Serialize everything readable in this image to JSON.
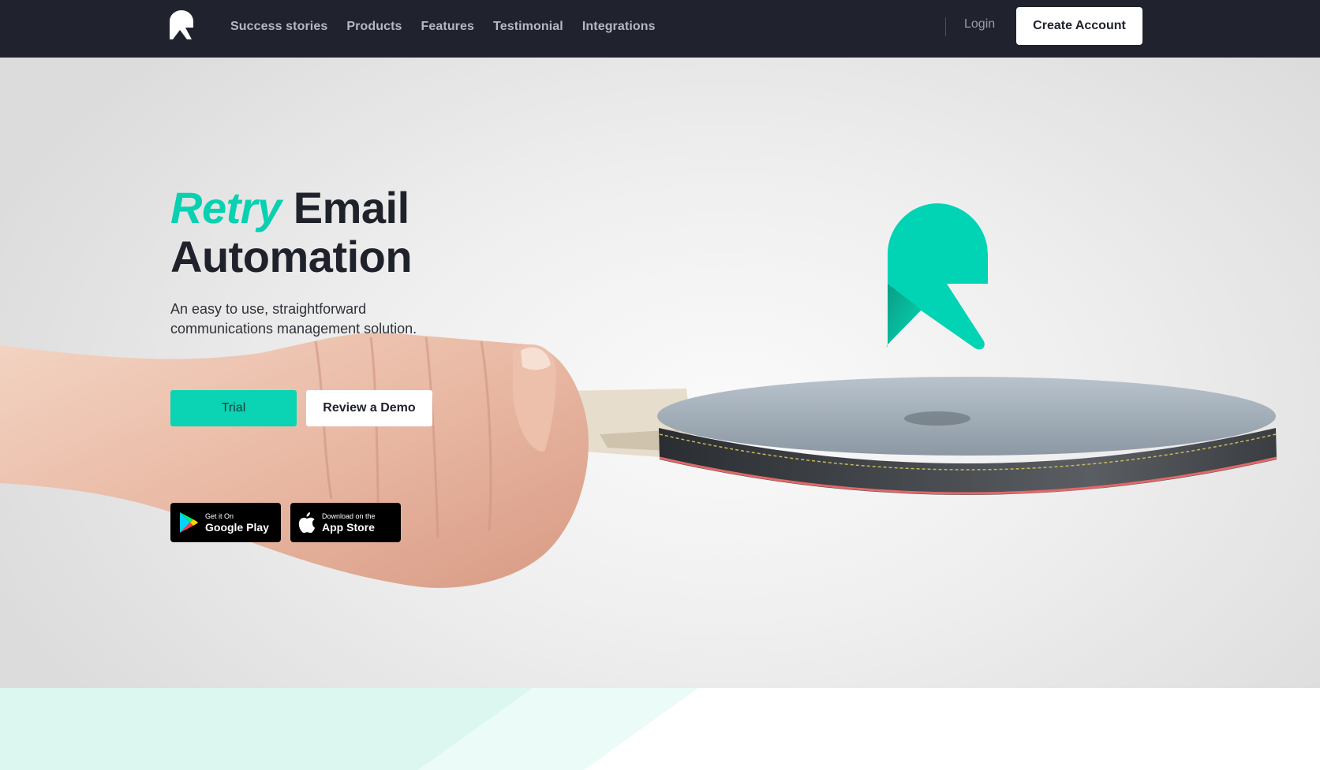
{
  "nav": {
    "logo_icon": "retry-r-logo-icon",
    "links": [
      "Success stories",
      "Products",
      "Features",
      "Testimonial",
      "Integrations"
    ],
    "login_label": "Login",
    "cta_label": "Create Account"
  },
  "hero": {
    "title_accent": "Retry",
    "title_rest_line1": "Email",
    "title_line2": "Automation",
    "subtitle": "An easy to use, straightforward communications management solution.",
    "trial_label": "Trial",
    "demo_label": "Review a Demo",
    "google_play": {
      "small": "Get it On",
      "big": "Google Play",
      "icon": "google-play-icon"
    },
    "app_store": {
      "small": "Download on the",
      "big": "App Store",
      "icon": "apple-icon"
    }
  },
  "colors": {
    "accent": "#08d1b1",
    "nav_bg": "#20232d",
    "text_dark": "#1f222b"
  }
}
